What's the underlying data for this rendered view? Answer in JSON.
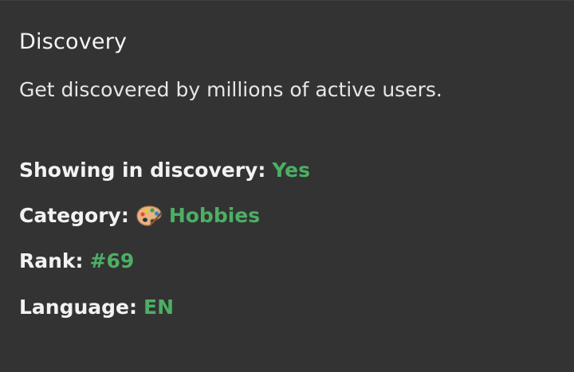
{
  "discovery": {
    "title": "Discovery",
    "subtitle": "Get discovered by millions of active users."
  },
  "stats": {
    "showing": {
      "label": "Showing in discovery:",
      "value": "Yes"
    },
    "category": {
      "label": "Category:",
      "icon": "artist-palette-icon",
      "value": "Hobbies"
    },
    "rank": {
      "label": "Rank:",
      "value": "#69"
    },
    "language": {
      "label": "Language:",
      "value": "EN"
    }
  },
  "colors": {
    "background": "#333333",
    "text": "#f2f2f2",
    "accent_green": "#4caf64"
  }
}
